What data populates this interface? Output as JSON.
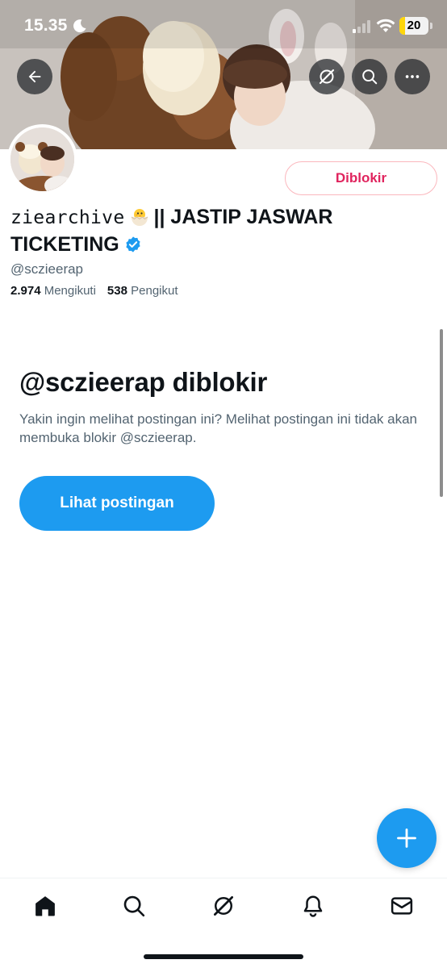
{
  "status_bar": {
    "time": "15.35",
    "battery_level": "20",
    "battery_fraction": 0.2
  },
  "header": {
    "back_icon": "arrow-left-icon",
    "actions": [
      "grok-icon",
      "search-icon",
      "more-icon"
    ]
  },
  "profile": {
    "display_name_styled": "ziearchive",
    "display_name_emoji": "hatching-chick",
    "display_name_rest": "|| JASTIP JASWAR TICKETING",
    "verified": true,
    "handle": "@sczieerap",
    "following_count": "2.974",
    "following_label": "Mengikuti",
    "followers_count": "538",
    "followers_label": "Pengikut",
    "blocked_button_label": "Diblokir"
  },
  "blocked_notice": {
    "title": "@sczieerap diblokir",
    "description": "Yakin ingin melihat postingan ini? Melihat postingan ini tidak akan membuka blokir @sczieerap.",
    "view_button_label": "Lihat postingan"
  },
  "tab_bar": {
    "items": [
      "home",
      "explore",
      "grok",
      "notifications",
      "messages"
    ],
    "active": "home"
  },
  "colors": {
    "accent": "#1d9bf0",
    "danger": "#e0245e",
    "text_primary": "#0f1419",
    "text_secondary": "#536471"
  }
}
